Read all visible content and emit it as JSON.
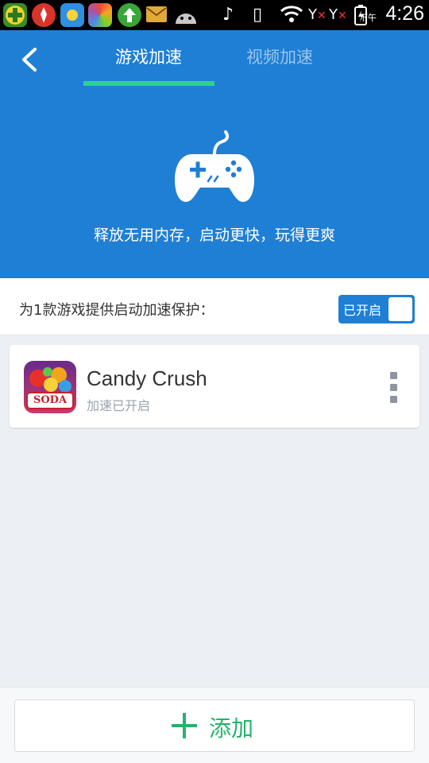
{
  "status_bar": {
    "ampm": "下午",
    "time": "4:26",
    "apps": [
      "plus-app-icon",
      "tool-app-icon",
      "weather-app-icon",
      "colorful-app-icon",
      "upload-app-icon",
      "mail-icon",
      "android-icon"
    ]
  },
  "header": {
    "tabs": [
      {
        "label": "游戏加速",
        "active": true
      },
      {
        "label": "视频加速",
        "active": false
      }
    ],
    "slogan": "释放无用内存，启动更快，玩得更爽",
    "accent_color": "#1f7fd4",
    "indicator_color": "#2fd18b"
  },
  "protection": {
    "text": "为1款游戏提供启动加速保护：",
    "toggle_label": "已开启",
    "toggle_on": true
  },
  "games": [
    {
      "name": "Candy Crush",
      "status": "加速已开启",
      "icon_text": "SODA"
    }
  ],
  "bottom": {
    "add_label": "添加",
    "add_color": "#22b46b"
  }
}
